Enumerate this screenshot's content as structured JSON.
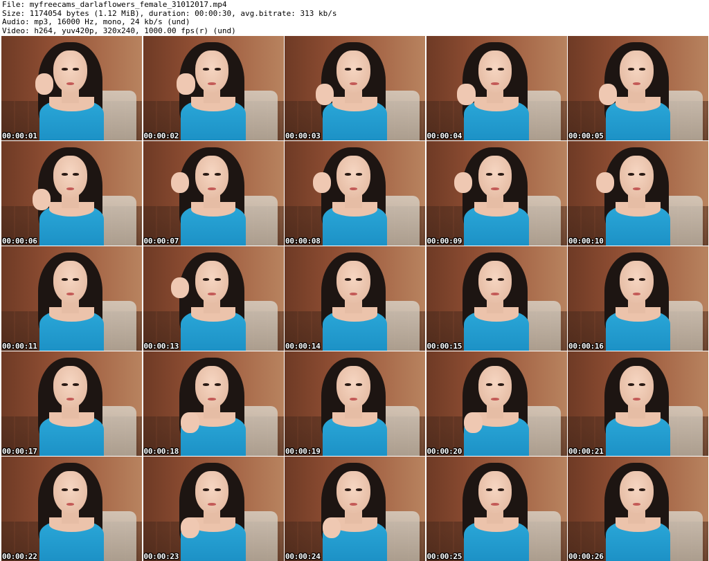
{
  "header": {
    "file_line": "File: myfreecams_darlaflowers_female_31012017.mp4",
    "size_line": "Size: 1174054 bytes (1.12 MiB), duration: 00:00:30, avg.bitrate: 313 kb/s",
    "audio_line": "Audio: mp3, 16000 Hz, mono, 24 kb/s (und)",
    "video_line": "Video: h264, yuv420p, 320x240, 1000.00 fps(r) (und)"
  },
  "thumbnails": [
    {
      "timestamp": "00:00:01",
      "pose": "v1"
    },
    {
      "timestamp": "00:00:02",
      "pose": "v1"
    },
    {
      "timestamp": "00:00:03",
      "pose": "v2"
    },
    {
      "timestamp": "00:00:04",
      "pose": "v2"
    },
    {
      "timestamp": "00:00:05",
      "pose": "v2"
    },
    {
      "timestamp": "00:00:06",
      "pose": "v2"
    },
    {
      "timestamp": "00:00:07",
      "pose": "v5"
    },
    {
      "timestamp": "00:00:08",
      "pose": "v5"
    },
    {
      "timestamp": "00:00:09",
      "pose": "v5"
    },
    {
      "timestamp": "00:00:10",
      "pose": "v5"
    },
    {
      "timestamp": "00:00:11",
      "pose": "v3"
    },
    {
      "timestamp": "00:00:13",
      "pose": "v5"
    },
    {
      "timestamp": "00:00:14",
      "pose": "v3"
    },
    {
      "timestamp": "00:00:15",
      "pose": "v3"
    },
    {
      "timestamp": "00:00:16",
      "pose": "v3"
    },
    {
      "timestamp": "00:00:17",
      "pose": "v3"
    },
    {
      "timestamp": "00:00:18",
      "pose": "v4"
    },
    {
      "timestamp": "00:00:19",
      "pose": "v3"
    },
    {
      "timestamp": "00:00:20",
      "pose": "v4"
    },
    {
      "timestamp": "00:00:21",
      "pose": "v3"
    },
    {
      "timestamp": "00:00:22",
      "pose": "v3"
    },
    {
      "timestamp": "00:00:23",
      "pose": "v4"
    },
    {
      "timestamp": "00:00:24",
      "pose": "v4"
    },
    {
      "timestamp": "00:00:25",
      "pose": "v3"
    },
    {
      "timestamp": "00:00:26",
      "pose": "v3"
    }
  ]
}
